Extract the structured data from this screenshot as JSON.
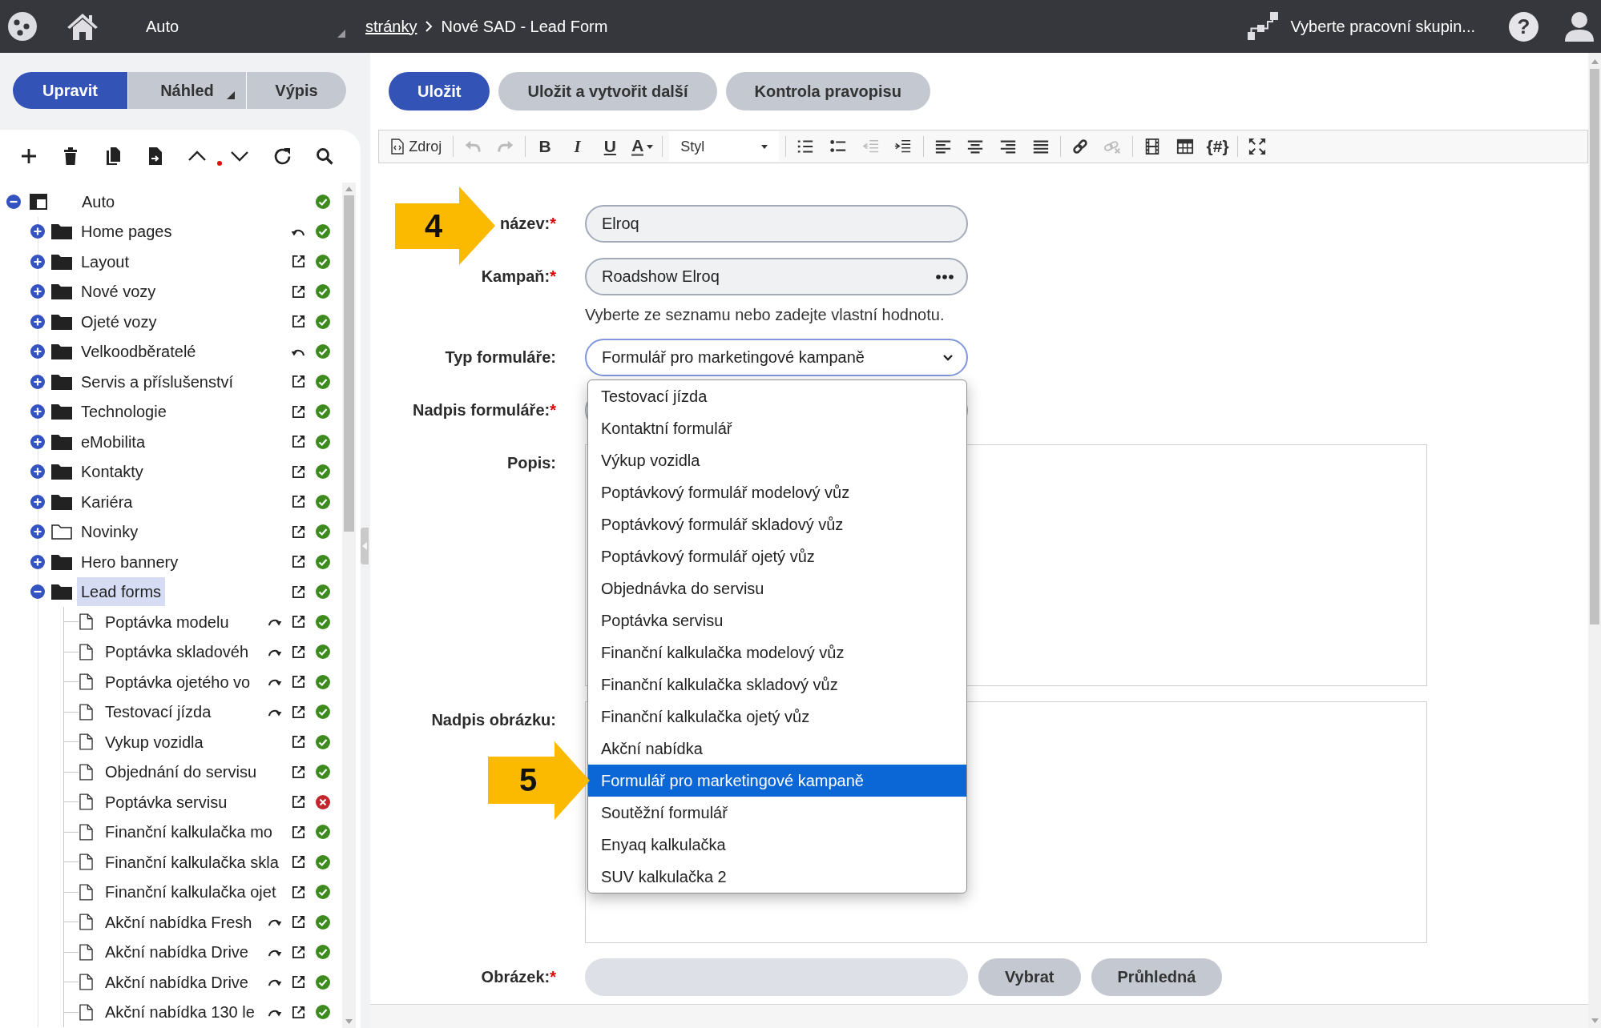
{
  "top_bar": {
    "domain": "Auto",
    "breadcrumb_link": "stránky",
    "page_title": "Nové SAD - Lead Form",
    "workgroup": "Vyberte pracovní skupin...",
    "help": "?"
  },
  "view_tabs": [
    {
      "label": "Upravit",
      "selected": true,
      "menu": false
    },
    {
      "label": "Náhled",
      "selected": false,
      "menu": true
    },
    {
      "label": "Výpis",
      "selected": false,
      "menu": false
    }
  ],
  "tree": [
    {
      "label": "Auto",
      "kind": "root",
      "expanded": true,
      "selected": false,
      "back_arrow": false,
      "forward_arrow": false,
      "external_link": false,
      "ok": true,
      "children": [
        {
          "label": "Home pages",
          "kind": "folder",
          "expanded": false,
          "selected": false,
          "back_arrow": true,
          "forward_arrow": false,
          "external_link": false,
          "ok": true
        },
        {
          "label": "Layout",
          "kind": "folder",
          "expanded": false,
          "selected": false,
          "back_arrow": false,
          "forward_arrow": false,
          "external_link": true,
          "ok": true
        },
        {
          "label": "Nové vozy",
          "kind": "folder",
          "expanded": false,
          "selected": false,
          "back_arrow": false,
          "forward_arrow": false,
          "external_link": true,
          "ok": true
        },
        {
          "label": "Ojeté vozy",
          "kind": "folder",
          "expanded": false,
          "selected": false,
          "back_arrow": false,
          "forward_arrow": false,
          "external_link": true,
          "ok": true
        },
        {
          "label": "Velkoodběratelé",
          "kind": "folder",
          "expanded": false,
          "selected": false,
          "back_arrow": true,
          "forward_arrow": false,
          "external_link": false,
          "ok": true
        },
        {
          "label": "Servis a příslušenství",
          "kind": "folder",
          "expanded": false,
          "selected": false,
          "back_arrow": false,
          "forward_arrow": false,
          "external_link": true,
          "ok": true
        },
        {
          "label": "Technologie",
          "kind": "folder",
          "expanded": false,
          "selected": false,
          "back_arrow": false,
          "forward_arrow": false,
          "external_link": true,
          "ok": true
        },
        {
          "label": "eMobilita",
          "kind": "folder",
          "expanded": false,
          "selected": false,
          "back_arrow": false,
          "forward_arrow": false,
          "external_link": true,
          "ok": true
        },
        {
          "label": "Kontakty",
          "kind": "folder",
          "expanded": false,
          "selected": false,
          "back_arrow": false,
          "forward_arrow": false,
          "external_link": true,
          "ok": true
        },
        {
          "label": "Kariéra",
          "kind": "folder",
          "expanded": false,
          "selected": false,
          "back_arrow": false,
          "forward_arrow": false,
          "external_link": true,
          "ok": true
        },
        {
          "label": "Novinky",
          "kind": "emptyfolder",
          "expanded": false,
          "selected": false,
          "back_arrow": false,
          "forward_arrow": false,
          "external_link": true,
          "ok": true
        },
        {
          "label": "Hero bannery",
          "kind": "folder",
          "expanded": false,
          "selected": false,
          "back_arrow": false,
          "forward_arrow": false,
          "external_link": true,
          "ok": true
        },
        {
          "label": "Lead forms",
          "kind": "folder",
          "expanded": true,
          "selected": true,
          "back_arrow": false,
          "forward_arrow": false,
          "external_link": true,
          "ok": true,
          "children": [
            {
              "label": "Poptávka modelu",
              "kind": "page",
              "selected": false,
              "back_arrow": false,
              "forward_arrow": true,
              "external_link": true,
              "ok": true
            },
            {
              "label": "Poptávka skladovéh",
              "kind": "page",
              "selected": false,
              "back_arrow": false,
              "forward_arrow": true,
              "external_link": true,
              "ok": true
            },
            {
              "label": "Poptávka ojetého vo",
              "kind": "page",
              "selected": false,
              "back_arrow": false,
              "forward_arrow": true,
              "external_link": true,
              "ok": true
            },
            {
              "label": "Testovací jízda",
              "kind": "page",
              "selected": false,
              "back_arrow": false,
              "forward_arrow": true,
              "external_link": true,
              "ok": true
            },
            {
              "label": "Vykup vozidla",
              "kind": "page",
              "selected": false,
              "back_arrow": false,
              "forward_arrow": false,
              "external_link": true,
              "ok": true
            },
            {
              "label": "Objednání do servisu",
              "kind": "page",
              "selected": false,
              "back_arrow": false,
              "forward_arrow": false,
              "external_link": true,
              "ok": true
            },
            {
              "label": "Poptávka servisu",
              "kind": "page",
              "selected": false,
              "back_arrow": false,
              "forward_arrow": false,
              "external_link": true,
              "ok": false
            },
            {
              "label": "Finanční kalkulačka mo",
              "kind": "page",
              "selected": false,
              "back_arrow": false,
              "forward_arrow": false,
              "external_link": true,
              "ok": true
            },
            {
              "label": "Finanční kalkulačka skla",
              "kind": "page",
              "selected": false,
              "back_arrow": false,
              "forward_arrow": false,
              "external_link": true,
              "ok": true
            },
            {
              "label": "Finanční kalkulačka ojet",
              "kind": "page",
              "selected": false,
              "back_arrow": false,
              "forward_arrow": false,
              "external_link": true,
              "ok": true
            },
            {
              "label": "Akční nabídka Fresh",
              "kind": "page",
              "selected": false,
              "back_arrow": false,
              "forward_arrow": true,
              "external_link": true,
              "ok": true
            },
            {
              "label": "Akční nabídka Drive",
              "kind": "page",
              "selected": false,
              "back_arrow": false,
              "forward_arrow": true,
              "external_link": true,
              "ok": true
            },
            {
              "label": "Akční nabídka Drive",
              "kind": "page",
              "selected": false,
              "back_arrow": false,
              "forward_arrow": true,
              "external_link": true,
              "ok": true
            },
            {
              "label": "Akční nabídka 130 le",
              "kind": "page",
              "selected": false,
              "back_arrow": false,
              "forward_arrow": true,
              "external_link": true,
              "ok": true
            }
          ]
        }
      ]
    }
  ],
  "actions": [
    {
      "label": "Uložit",
      "primary": true
    },
    {
      "label": "Uložit a vytvořit další",
      "primary": false
    },
    {
      "label": "Kontrola pravopisu",
      "primary": false
    }
  ],
  "editor_toolbar": [
    {
      "kind": "source",
      "label": "Zdroj",
      "disabled": false
    },
    {
      "kind": "separator"
    },
    {
      "kind": "icon",
      "disabled": true
    },
    {
      "kind": "icon",
      "disabled": true
    },
    {
      "kind": "separator"
    },
    {
      "kind": "bold",
      "label": "B",
      "disabled": false
    },
    {
      "kind": "italic",
      "label": "I",
      "disabled": false
    },
    {
      "kind": "underline",
      "label": "U",
      "disabled": false
    },
    {
      "kind": "color",
      "label": "A",
      "disabled": false
    },
    {
      "kind": "separator"
    },
    {
      "kind": "combo",
      "label": "Styl",
      "disabled": false
    },
    {
      "kind": "separator"
    },
    {
      "kind": "icon",
      "disabled": false
    },
    {
      "kind": "icon",
      "disabled": false
    },
    {
      "kind": "icon",
      "disabled": true
    },
    {
      "kind": "icon",
      "disabled": false
    },
    {
      "kind": "separator"
    },
    {
      "kind": "icon",
      "disabled": false
    },
    {
      "kind": "icon",
      "disabled": false
    },
    {
      "kind": "icon",
      "disabled": false
    },
    {
      "kind": "icon",
      "disabled": false
    },
    {
      "kind": "separator"
    },
    {
      "kind": "icon",
      "disabled": false
    },
    {
      "kind": "icon",
      "disabled": true
    },
    {
      "kind": "separator"
    },
    {
      "kind": "icon",
      "disabled": false
    },
    {
      "kind": "icon",
      "disabled": false
    },
    {
      "kind": "symbol",
      "label": "{#}",
      "disabled": false
    },
    {
      "kind": "separator"
    },
    {
      "kind": "icon",
      "disabled": false
    }
  ],
  "form": {
    "fields": [
      {
        "label": "název:",
        "required_mark": "*",
        "kind": "text",
        "value": "Elroq"
      },
      {
        "label": "Kampaň:",
        "required_mark": "*",
        "kind": "picker",
        "value": "Roadshow Elroq",
        "hint": "Vyberte ze seznamu nebo zadejte vlastní hodnotu."
      },
      {
        "label": "Typ formuláře:",
        "kind": "select",
        "value": "Formulář pro marketingové kampaně",
        "open": true,
        "options": [
          {
            "label": "Testovací jízda",
            "selected": false
          },
          {
            "label": "Kontaktní formulář",
            "selected": false
          },
          {
            "label": "Výkup vozidla",
            "selected": false
          },
          {
            "label": "Poptávkový formulář modelový vůz",
            "selected": false
          },
          {
            "label": "Poptávkový formulář skladový vůz",
            "selected": false
          },
          {
            "label": "Poptávkový formulář ojetý vůz",
            "selected": false
          },
          {
            "label": "Objednávka do servisu",
            "selected": false
          },
          {
            "label": "Poptávka servisu",
            "selected": false
          },
          {
            "label": "Finanční kalkulačka modelový vůz",
            "selected": false
          },
          {
            "label": "Finanční kalkulačka skladový vůz",
            "selected": false
          },
          {
            "label": "Finanční kalkulačka ojetý vůz",
            "selected": false
          },
          {
            "label": "Akční nabídka",
            "selected": false
          },
          {
            "label": "Formulář pro marketingové kampaně",
            "selected": true
          },
          {
            "label": "Soutěžní formulář",
            "selected": false
          },
          {
            "label": "Enyaq kalkulačka",
            "selected": false
          },
          {
            "label": "SUV kalkulačka 2",
            "selected": false
          }
        ]
      },
      {
        "label": "Nadpis formuláře:",
        "required_mark": "*",
        "kind": "text"
      },
      {
        "label": "Popis:",
        "kind": "area"
      },
      {
        "label": "Nadpis obrázku:",
        "kind": "area"
      },
      {
        "label": "Obrázek:",
        "required_mark": "*",
        "kind": "image",
        "buttons": [
          "Vybrat",
          "Průhledná"
        ]
      }
    ]
  },
  "callouts": [
    {
      "label": "4"
    },
    {
      "label": "5"
    }
  ]
}
